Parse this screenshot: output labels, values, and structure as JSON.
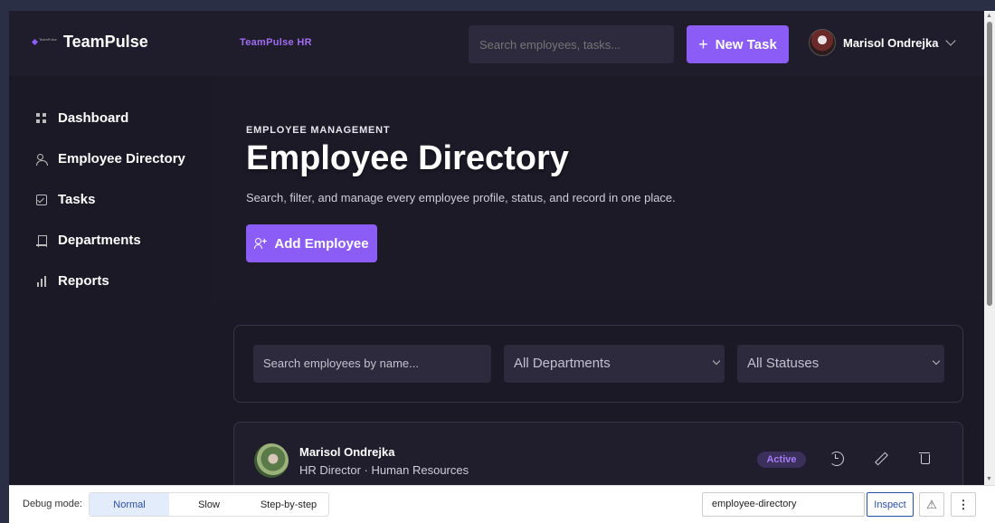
{
  "brand": {
    "name": "TeamPulse",
    "logo_text": "TeamPulse",
    "subtitle": "TeamPulse HR"
  },
  "header": {
    "search_placeholder": "Search employees, tasks...",
    "new_task_label": "New Task",
    "user_name": "Marisol Ondrejka"
  },
  "sidebar": {
    "items": [
      {
        "label": "Dashboard",
        "icon": "grid-icon"
      },
      {
        "label": "Employee Directory",
        "icon": "users-icon"
      },
      {
        "label": "Tasks",
        "icon": "checkbox-icon"
      },
      {
        "label": "Departments",
        "icon": "building-icon"
      },
      {
        "label": "Reports",
        "icon": "bar-chart-icon"
      }
    ]
  },
  "hero": {
    "eyebrow": "EMPLOYEE MANAGEMENT",
    "title": "Employee Directory",
    "description": "Search, filter, and manage every employee profile, status, and record in one place.",
    "add_button_label": "Add Employee"
  },
  "filters": {
    "search_placeholder": "Search employees by name...",
    "department_selected": "All Departments",
    "status_selected": "All Statuses"
  },
  "employees": [
    {
      "name": "Marisol Ondrejka",
      "role": "HR Director · Human Resources",
      "status": "Active"
    }
  ],
  "debug": {
    "label": "Debug mode:",
    "modes": [
      "Normal",
      "Slow",
      "Step-by-step"
    ],
    "active_mode": "Normal",
    "target_value": "employee-directory",
    "inspect_label": "Inspect",
    "more_glyph": "⋮",
    "warn_glyph": "⚠"
  },
  "colors": {
    "accent": "#8b5cf6",
    "background": "#1b1926",
    "status_active": "#a57cf5"
  }
}
